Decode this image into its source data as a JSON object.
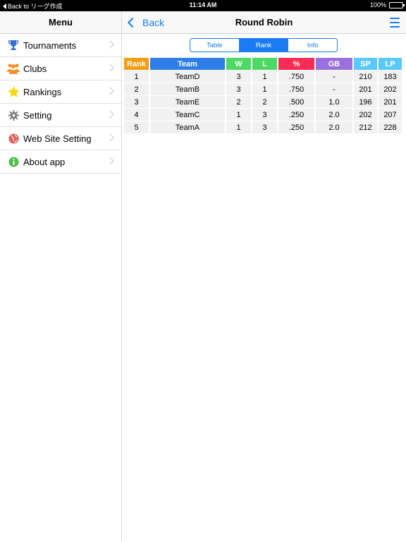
{
  "status_bar": {
    "back_label": "Back to リーグ作成",
    "time": "11:14 AM",
    "battery": "100%",
    "battery_level": 1.0
  },
  "sidebar": {
    "title": "Menu",
    "items": [
      {
        "label": "Tournaments",
        "icon": "trophy-icon",
        "color": "#2f6fd6"
      },
      {
        "label": "Clubs",
        "icon": "people-icon",
        "color": "#f0932b"
      },
      {
        "label": "Rankings",
        "icon": "star-icon",
        "color": "#f5d90f"
      },
      {
        "label": "Setting",
        "icon": "gear-icon",
        "color": "#7a7a7a"
      },
      {
        "label": "Web Site Setting",
        "icon": "globe-icon",
        "color": "#e0605a"
      },
      {
        "label": "About app",
        "icon": "info-icon",
        "color": "#4cbf4c"
      }
    ]
  },
  "header": {
    "back_label": "Back",
    "title": "Round Robin",
    "accent": "#1a7cf5"
  },
  "segments": {
    "items": [
      "Table",
      "Rank",
      "Info"
    ],
    "selected": "Rank"
  },
  "table": {
    "columns": [
      {
        "label": "Rank",
        "color": "#f39c12"
      },
      {
        "label": "Team",
        "color": "#2d7ee8"
      },
      {
        "label": "W",
        "color": "#4cd964"
      },
      {
        "label": "L",
        "color": "#4cd964"
      },
      {
        "label": "%",
        "color": "#ff2d55"
      },
      {
        "label": "GB",
        "color": "#9b6fde"
      },
      {
        "label": "SP",
        "color": "#5ac8fa"
      },
      {
        "label": "LP",
        "color": "#5ac8fa"
      }
    ],
    "rows": [
      [
        "1",
        "TeamD",
        "3",
        "1",
        ".750",
        "-",
        "210",
        "183"
      ],
      [
        "2",
        "TeamB",
        "3",
        "1",
        ".750",
        "-",
        "201",
        "202"
      ],
      [
        "3",
        "TeamE",
        "2",
        "2",
        ".500",
        "1.0",
        "196",
        "201"
      ],
      [
        "4",
        "TeamC",
        "1",
        "3",
        ".250",
        "2.0",
        "202",
        "207"
      ],
      [
        "5",
        "TeamA",
        "1",
        "3",
        ".250",
        "2.0",
        "212",
        "228"
      ]
    ]
  }
}
